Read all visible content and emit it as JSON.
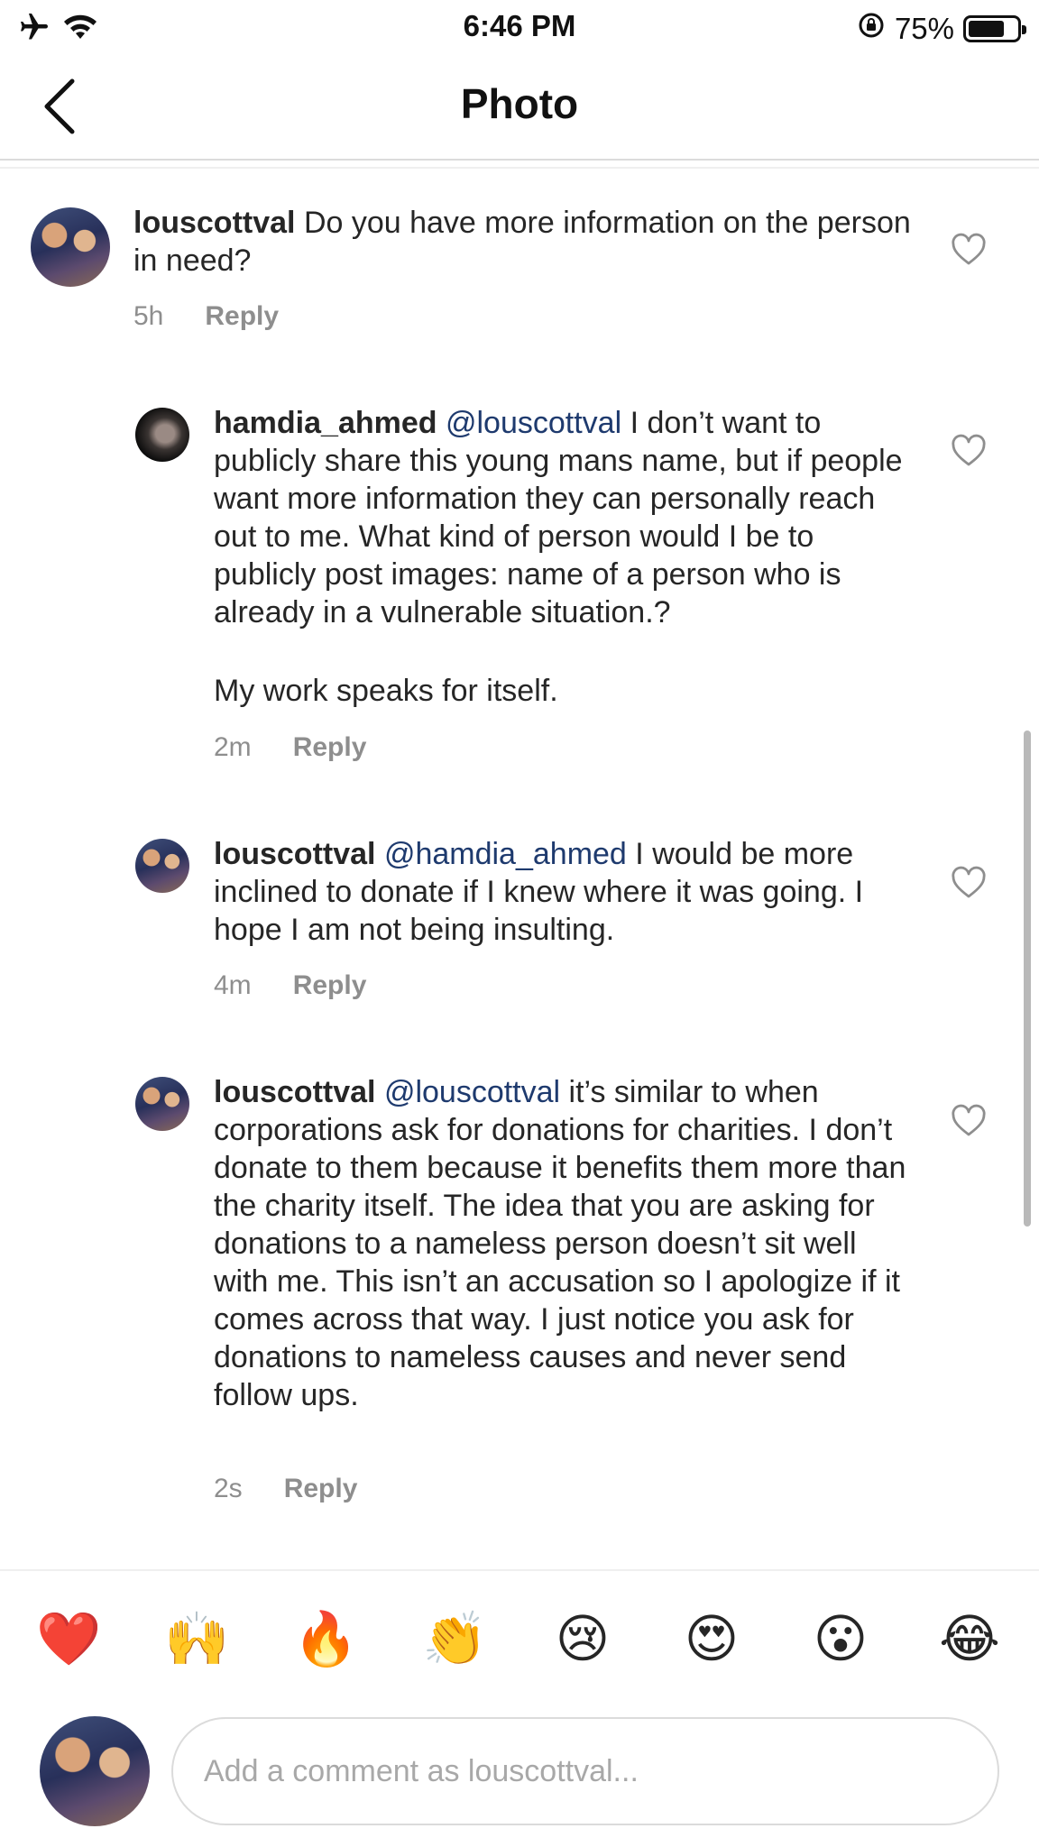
{
  "status_bar": {
    "time": "6:46 PM",
    "battery": "75%",
    "battery_level": 0.75,
    "icons": [
      "airplane-icon",
      "wifi-icon",
      "orientation-lock-icon",
      "battery-icon"
    ]
  },
  "header": {
    "title": "Photo",
    "back_icon": "chevron-left-icon"
  },
  "comments": [
    {
      "username": "louscottval",
      "mention": "",
      "text": "Do you have more information on the person in need?",
      "extra": "",
      "time": "5h",
      "reply_label": "Reply"
    },
    {
      "username": "hamdia_ahmed",
      "mention": "@louscottval",
      "text": "I don’t want to publicly share this young mans name, but if people want more information they can personally reach out to me.  What kind of person would I be to publicly post images: name of a person who is already in a vulnerable situation.?",
      "extra": "My work speaks for itself.",
      "time": "2m",
      "reply_label": "Reply"
    },
    {
      "username": "louscottval",
      "mention": "@hamdia_ahmed",
      "text": "I would be more inclined to donate if I knew where it was going. I hope I am not being insulting.",
      "extra": "",
      "time": "4m",
      "reply_label": "Reply"
    },
    {
      "username": "louscottval",
      "mention": "@louscottval",
      "text": "it’s similar to when corporations ask for donations for charities. I don’t donate to them because it benefits them more than the charity itself. The idea that you are asking for donations to a nameless person doesn’t sit well with me. This isn’t an accusation so I apologize if it comes across that way. I just notice you ask for donations to nameless causes and never send follow ups.",
      "extra": "",
      "time": "2s",
      "reply_label": "Reply"
    }
  ],
  "emoji_bar": [
    "❤️",
    "🙌",
    "🔥",
    "👏",
    "😢",
    "😍",
    "😮",
    "😂"
  ],
  "composer": {
    "placeholder": "Add a comment as louscottval..."
  },
  "colors": {
    "text": "#262626",
    "secondary": "#8e8e8e",
    "mention": "#1e3a6e",
    "divider": "#dbdbdb"
  }
}
